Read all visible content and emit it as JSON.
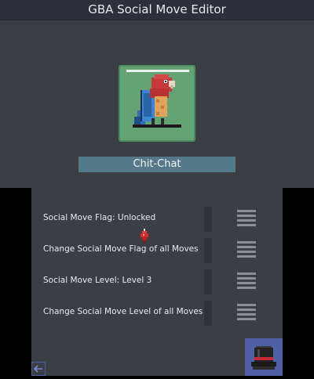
{
  "window": {
    "title": "GBA Social Move Editor"
  },
  "move": {
    "name": "Chit-Chat",
    "icon": "parrot-icon"
  },
  "options": [
    {
      "label": "Social Move Flag: Unlocked"
    },
    {
      "label": "Change Social Move Flag of all Moves"
    },
    {
      "label": "Social Move Level: Level 3"
    },
    {
      "label": "Change Social Move Level of all Moves"
    }
  ],
  "icons": {
    "cursor": "red-pointer-icon",
    "hat": "top-hat-icon",
    "back": "back-arrow-icon",
    "menu": "hamburger-icon"
  },
  "colors": {
    "background": "#3b3e45",
    "title_bar": "#2d3038",
    "name_bar": "#547a8a",
    "portrait": "#64a374",
    "accent": "#4f5fa8"
  }
}
